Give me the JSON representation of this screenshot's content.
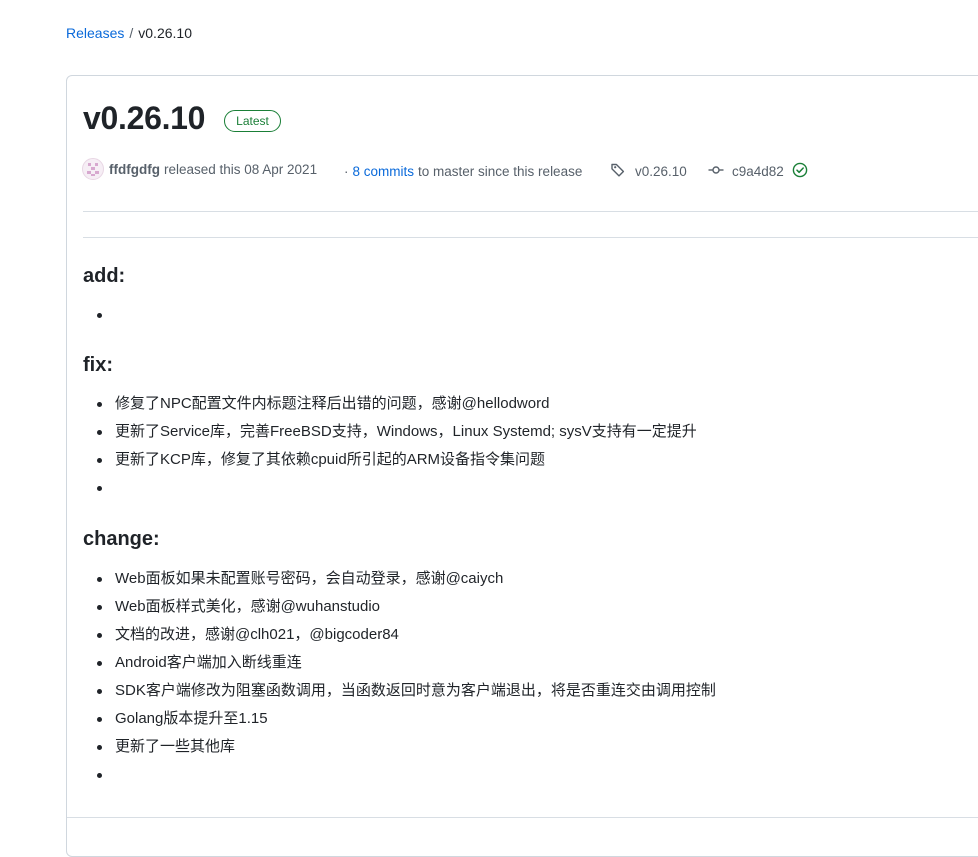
{
  "breadcrumb": {
    "releases_link": "Releases",
    "separator": "/",
    "current": "v0.26.10"
  },
  "release": {
    "title": "v0.26.10",
    "badge": "Latest",
    "author": "ffdfgdfg",
    "released_text": "released this 08 Apr 2021",
    "commits_prefix": "·",
    "commits_link": "8 commits",
    "commits_suffix": "to master since this release",
    "tag": "v0.26.10",
    "commit_sha": "c9a4d82"
  },
  "notes": {
    "add_heading": "add:",
    "add_items": [
      ""
    ],
    "fix_heading": "fix:",
    "fix_items": [
      "修复了NPC配置文件内标题注释后出错的问题，感谢@hellodword",
      "更新了Service库，完善FreeBSD支持，Windows，Linux Systemd; sysV支持有一定提升",
      "更新了KCP库，修复了其依赖cpuid所引起的ARM设备指令集问题",
      ""
    ],
    "change_heading": "change:",
    "change_items": [
      "Web面板如果未配置账号密码，会自动登录，感谢@caiych",
      "Web面板样式美化，感谢@wuhanstudio",
      "文档的改进，感谢@clh021，@bigcoder84",
      "Android客户端加入断线重连",
      "SDK客户端修改为阻塞函数调用，当函数返回时意为客户端退出，将是否重连交由调用控制",
      "Golang版本提升至1.15",
      "更新了一些其他库",
      ""
    ]
  },
  "icons": {
    "tag": "tag-icon",
    "commit": "git-commit-icon",
    "verified": "check-circle-icon"
  },
  "colors": {
    "link": "#0969da",
    "latest_badge": "#1a7f37",
    "verified": "#1a7f37",
    "muted": "#57606a"
  }
}
